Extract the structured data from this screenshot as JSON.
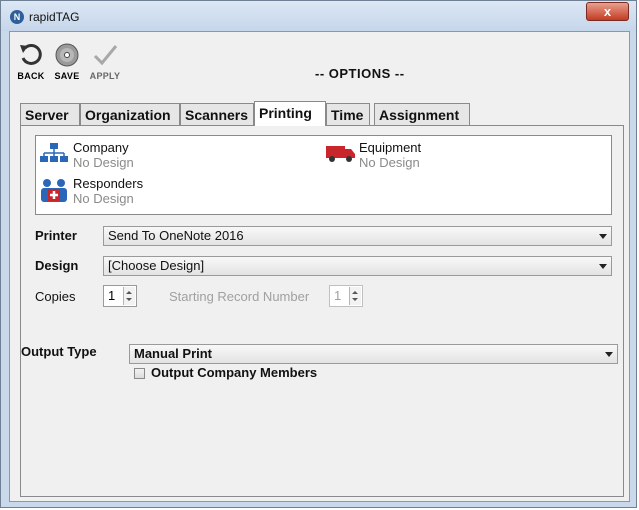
{
  "window": {
    "title": "rapidTAG",
    "close_label": "x"
  },
  "toolbar": {
    "back_label": "BACK",
    "save_label": "SAVE",
    "apply_label": "APPLY",
    "heading": "-- OPTIONS --"
  },
  "tabs": [
    {
      "label": "Server"
    },
    {
      "label": "Organization"
    },
    {
      "label": "Scanners"
    },
    {
      "label": "Printing",
      "active": true
    },
    {
      "label": "Time"
    },
    {
      "label": "Assignment"
    }
  ],
  "designs": {
    "company": {
      "name": "Company",
      "status": "No Design",
      "icon": "org-chart-icon"
    },
    "equipment": {
      "name": "Equipment",
      "status": "No Design",
      "icon": "truck-icon"
    },
    "responders": {
      "name": "Responders",
      "status": "No Design",
      "icon": "responders-icon"
    }
  },
  "printer": {
    "label": "Printer",
    "value": "Send To OneNote 2016"
  },
  "design": {
    "label": "Design",
    "value": "[Choose Design]"
  },
  "copies": {
    "label": "Copies",
    "value": "1"
  },
  "starting_record": {
    "label": "Starting Record Number",
    "value": "1"
  },
  "output_type": {
    "label": "Output Type",
    "value": "Manual Print"
  },
  "output_members": {
    "label": "Output Company Members",
    "checked": false
  },
  "colors": {
    "accent_red": "#c8262b",
    "org_blue": "#2a67b8"
  }
}
